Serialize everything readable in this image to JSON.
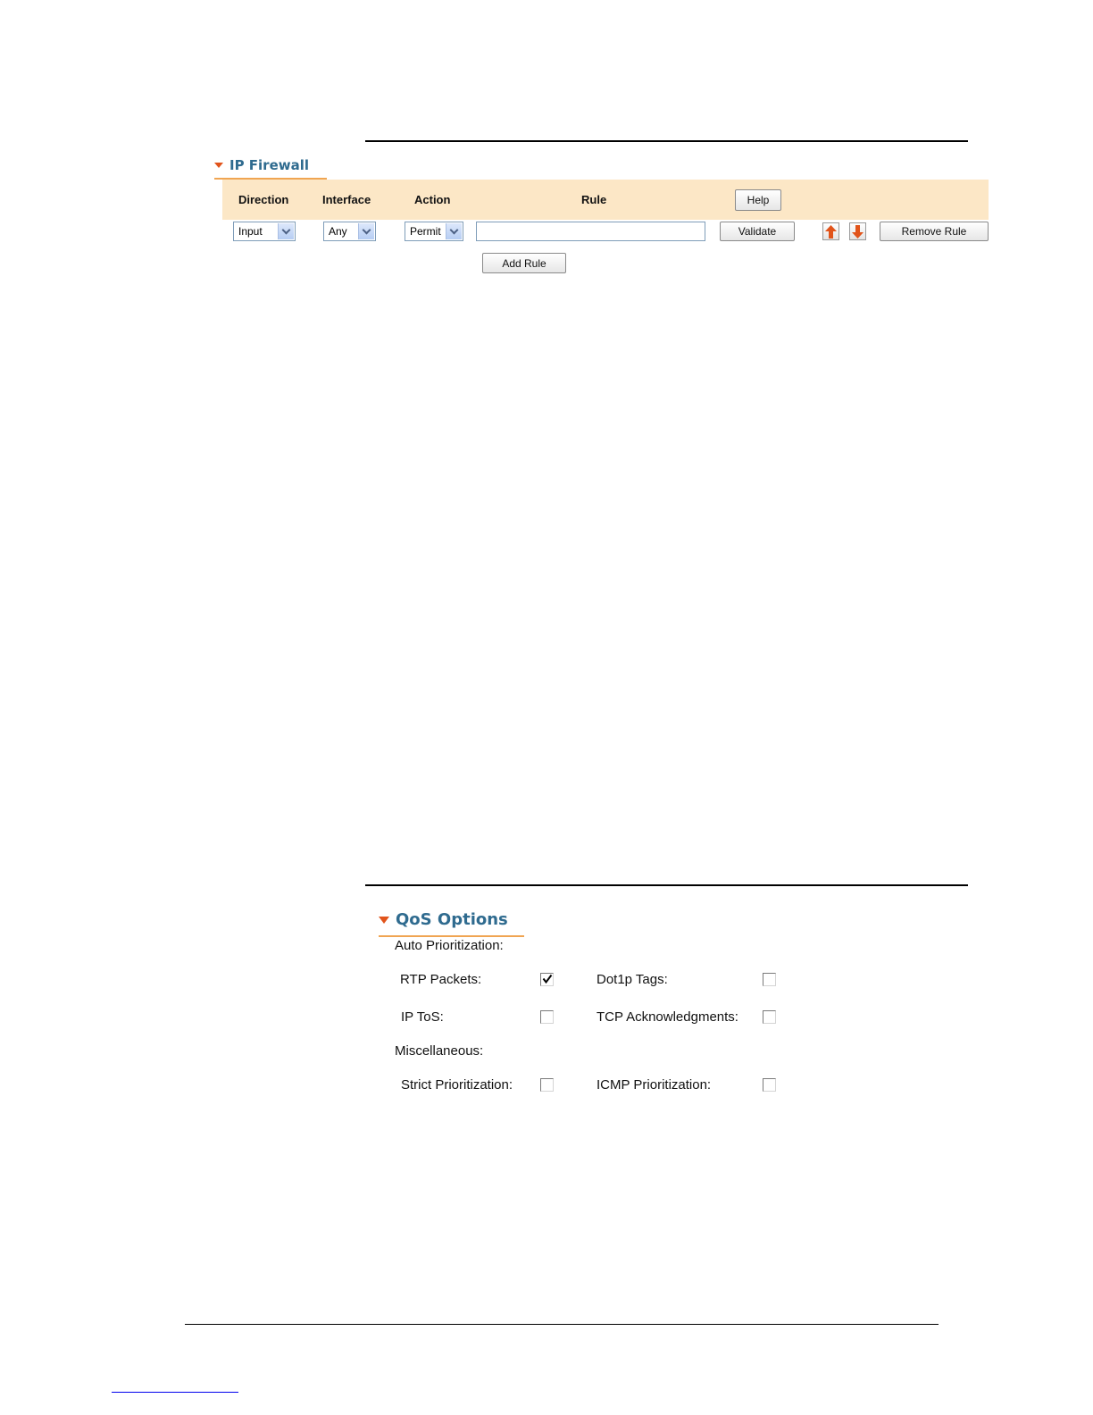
{
  "firewall": {
    "title": "IP Firewall",
    "columns": {
      "direction": "Direction",
      "interface": "Interface",
      "action": "Action",
      "rule": "Rule"
    },
    "help_label": "Help",
    "row": {
      "direction_value": "Input",
      "interface_value": "Any",
      "action_value": "Permit",
      "rule_value": "",
      "validate_label": "Validate",
      "remove_label": "Remove Rule"
    },
    "add_rule_label": "Add Rule",
    "accent_color": "#e1541b",
    "header_bg": "#fce7c6"
  },
  "qos": {
    "title": "QoS Options",
    "auto_heading": "Auto Prioritization:",
    "misc_heading": "Miscellaneous:",
    "options": {
      "rtp": {
        "label": "RTP Packets:",
        "checked": true
      },
      "dot1p": {
        "label": "Dot1p Tags:",
        "checked": false
      },
      "iptos": {
        "label": "IP ToS:",
        "checked": false
      },
      "tcpack": {
        "label": "TCP Acknowledgments:",
        "checked": false
      },
      "strict": {
        "label": "Strict Prioritization:",
        "checked": false
      },
      "icmp": {
        "label": "ICMP Prioritization:",
        "checked": false
      }
    }
  },
  "icons": {
    "collapse": "triangle-down-icon",
    "move_up": "arrow-up-icon",
    "move_down": "arrow-down-icon",
    "dropdown": "chevron-down-icon",
    "check": "checkmark-icon"
  }
}
